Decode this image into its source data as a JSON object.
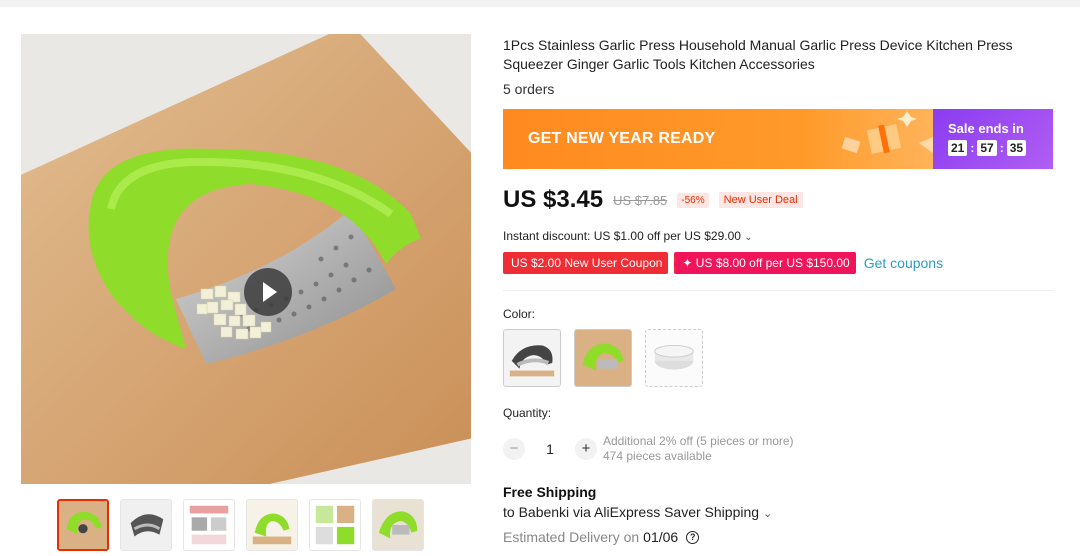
{
  "product": {
    "title": "1Pcs Stainless Garlic Press Household Manual Garlic Press Device Kitchen Press Squeezer Ginger Garlic Tools Kitchen Accessories",
    "orders": "5 orders"
  },
  "banner": {
    "promo_text": "GET NEW YEAR READY",
    "sale_label": "Sale ends in",
    "timer": {
      "hours": "21",
      "minutes": "57",
      "seconds": "35"
    }
  },
  "price": {
    "current": "US $3.45",
    "original": "US $7.85",
    "discount": "-56%",
    "deal_tag": "New User Deal"
  },
  "instant_discount": "Instant discount: US $1.00 off per US $29.00",
  "coupons": {
    "new_user": "US $2.00 New User Coupon",
    "store": "✦ US $8.00 off per US $150.00",
    "get_link": "Get coupons"
  },
  "color": {
    "label": "Color:"
  },
  "quantity": {
    "label": "Quantity:",
    "minus": "−",
    "value": "1",
    "plus": "+",
    "note": "Additional 2% off (5 pieces or more)",
    "available": "474 pieces available"
  },
  "shipping": {
    "title": "Free Shipping",
    "to": "to Babenki via AliExpress Saver Shipping",
    "delivery_prefix": "Estimated Delivery on",
    "delivery_date": "01/06"
  },
  "colors": {
    "accent_red": "#e62e04",
    "banner_orange": "#ff8a1f",
    "banner_purple": "#8a3cf0",
    "link_blue": "#2e9cc3",
    "product_green": "#8fdc2a"
  },
  "icons": {
    "play": "play-icon",
    "chevron": "chevron-down-icon",
    "help": "question-circle-icon"
  }
}
